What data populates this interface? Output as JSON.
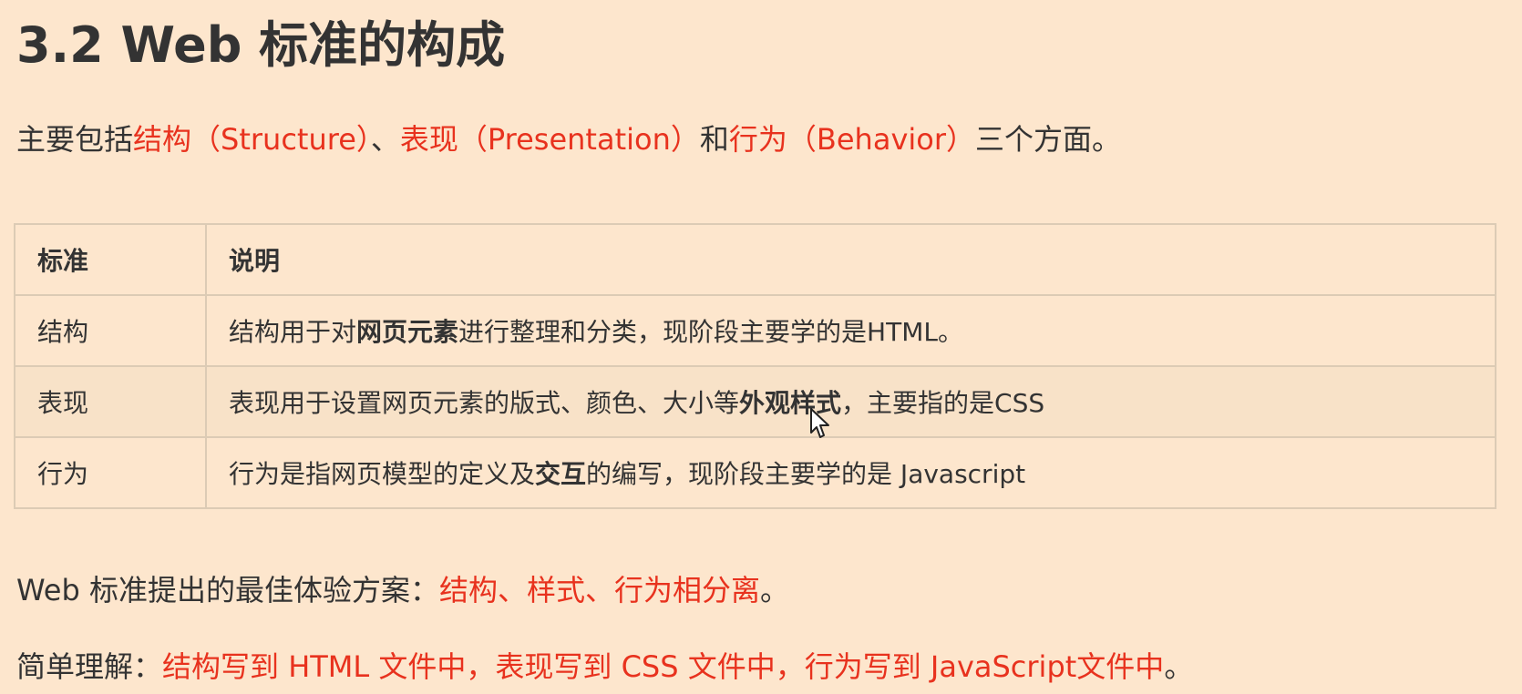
{
  "title": "3.2 Web 标准的构成",
  "intro": {
    "prefix": "主要包括",
    "structure": "结构（Structure）",
    "sep1": "、",
    "presentation": "表现（Presentation）",
    "sep2": "和",
    "behavior": "行为（Behavior）",
    "suffix": "三个方面。"
  },
  "table": {
    "headers": [
      "标准",
      "说明"
    ],
    "rows": [
      {
        "name": "结构",
        "desc_before": "结构用于对",
        "desc_bold": "网页元素",
        "desc_after": "进行整理和分类，现阶段主要学的是HTML。"
      },
      {
        "name": "表现",
        "desc_before": "表现用于设置网页元素的版式、颜色、大小等",
        "desc_bold": "外观样式",
        "desc_after": "，主要指的是CSS"
      },
      {
        "name": "行为",
        "desc_before": "行为是指网页模型的定义及",
        "desc_bold": "交互",
        "desc_after": "的编写，现阶段主要学的是 Javascript"
      }
    ]
  },
  "summary": {
    "label": "Web 标准提出的最佳体验方案：",
    "value": "结构、样式、行为相分离",
    "end": "。"
  },
  "simple": {
    "label": "简单理解：",
    "value": "结构写到 HTML 文件中，表现写到 CSS 文件中，行为写到 JavaScript文件中",
    "end": "。"
  },
  "colors": {
    "background": "#fde6cd",
    "accent": "#e8321e",
    "text": "#333333"
  },
  "icons": {
    "cursor": "mouse-pointer-icon"
  }
}
